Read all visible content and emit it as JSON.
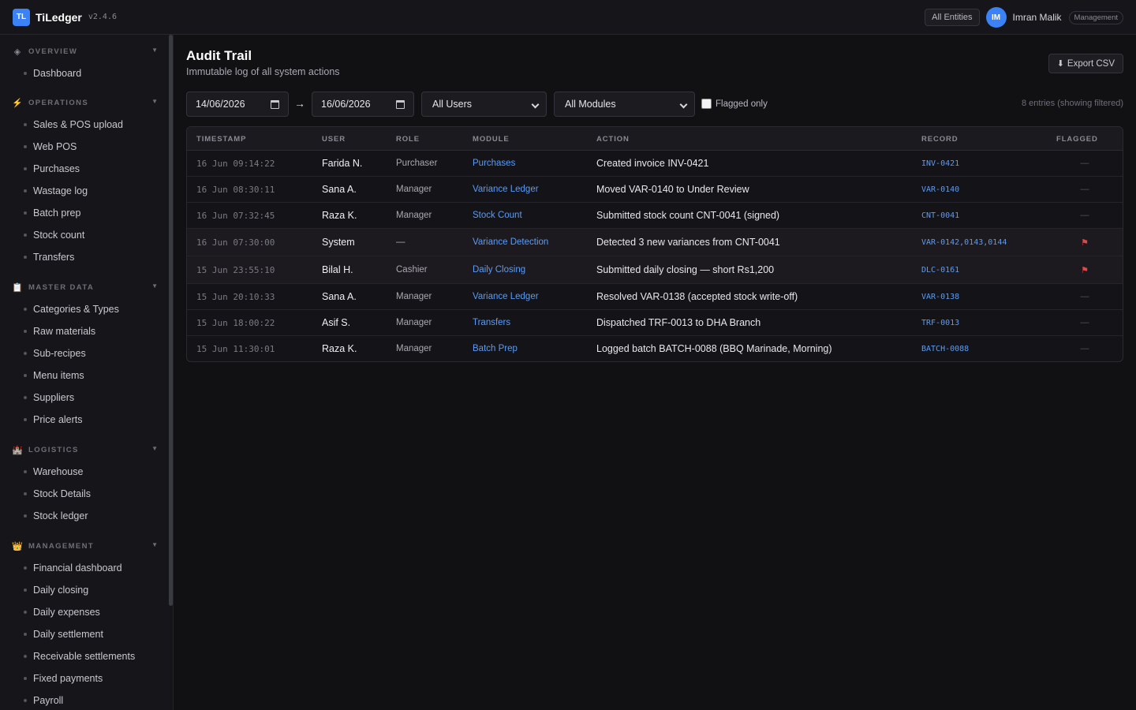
{
  "app": {
    "logo": "TL",
    "name": "TiLedger",
    "version": "v2.4.6"
  },
  "topbar": {
    "entities_label": "All Entities",
    "avatar_initials": "IM",
    "user_name": "Imran Malik",
    "role_badge": "Management"
  },
  "sidebar": {
    "sections": [
      {
        "title": "OVERVIEW",
        "icon": "diamond-icon",
        "icon_glyph": "◈",
        "items": [
          "Dashboard"
        ]
      },
      {
        "title": "OPERATIONS",
        "icon": "lightning-icon",
        "icon_glyph": "⚡",
        "items": [
          "Sales & POS upload",
          "Web POS",
          "Purchases",
          "Wastage log",
          "Batch prep",
          "Stock count",
          "Transfers"
        ]
      },
      {
        "title": "MASTER DATA",
        "icon": "clipboard-icon",
        "icon_glyph": "📋",
        "items": [
          "Categories & Types",
          "Raw materials",
          "Sub-recipes",
          "Menu items",
          "Suppliers",
          "Price alerts"
        ]
      },
      {
        "title": "LOGISTICS",
        "icon": "castle-icon",
        "icon_glyph": "🏰",
        "items": [
          "Warehouse",
          "Stock Details",
          "Stock ledger"
        ]
      },
      {
        "title": "MANAGEMENT",
        "icon": "crown-icon",
        "icon_glyph": "👑",
        "items": [
          "Financial dashboard",
          "Daily closing",
          "Daily expenses",
          "Daily settlement",
          "Receivable settlements",
          "Fixed payments",
          "Payroll"
        ]
      }
    ]
  },
  "page": {
    "title": "Audit Trail",
    "subtitle": "Immutable log of all system actions",
    "export_label": "Export CSV",
    "export_icon": "download-icon"
  },
  "filters": {
    "date_from": "14/06/2026",
    "arrow": "→",
    "date_to": "16/06/2026",
    "user_select": "All Users",
    "module_select": "All Modules",
    "flagged_label": "Flagged only",
    "flagged_checked": false,
    "entries_text": "8 entries (showing filtered)"
  },
  "table": {
    "columns": [
      "TIMESTAMP",
      "USER",
      "ROLE",
      "MODULE",
      "ACTION",
      "RECORD",
      "FLAGGED"
    ],
    "rows": [
      {
        "timestamp": "16 Jun 09:14:22",
        "user": "Farida N.",
        "role": "Purchaser",
        "module": "Purchases",
        "action": "Created invoice INV-0421",
        "record": "INV-0421",
        "flagged": false,
        "flag_text": "—"
      },
      {
        "timestamp": "16 Jun 08:30:11",
        "user": "Sana A.",
        "role": "Manager",
        "module": "Variance Ledger",
        "action": "Moved VAR-0140 to Under Review",
        "record": "VAR-0140",
        "flagged": false,
        "flag_text": "—"
      },
      {
        "timestamp": "16 Jun 07:32:45",
        "user": "Raza K.",
        "role": "Manager",
        "module": "Stock Count",
        "action": "Submitted stock count CNT-0041 (signed)",
        "record": "CNT-0041",
        "flagged": false,
        "flag_text": "—"
      },
      {
        "timestamp": "16 Jun 07:30:00",
        "user": "System",
        "role": "—",
        "module": "Variance Detection",
        "action": "Detected 3 new variances from CNT-0041",
        "record": "VAR-0142,0143,0144",
        "flagged": true,
        "flag_text": "⚑"
      },
      {
        "timestamp": "15 Jun 23:55:10",
        "user": "Bilal H.",
        "role": "Cashier",
        "module": "Daily Closing",
        "action": "Submitted daily closing — short Rs1,200",
        "record": "DLC-0161",
        "flagged": true,
        "flag_text": "⚑"
      },
      {
        "timestamp": "15 Jun 20:10:33",
        "user": "Sana A.",
        "role": "Manager",
        "module": "Variance Ledger",
        "action": "Resolved VAR-0138 (accepted stock write-off)",
        "record": "VAR-0138",
        "flagged": false,
        "flag_text": "—"
      },
      {
        "timestamp": "15 Jun 18:00:22",
        "user": "Asif S.",
        "role": "Manager",
        "module": "Transfers",
        "action": "Dispatched TRF-0013 to DHA Branch",
        "record": "TRF-0013",
        "flagged": false,
        "flag_text": "—"
      },
      {
        "timestamp": "15 Jun 11:30:01",
        "user": "Raza K.",
        "role": "Manager",
        "module": "Batch Prep",
        "action": "Logged batch BATCH-0088 (BBQ Marinade, Morning)",
        "record": "BATCH-0088",
        "flagged": false,
        "flag_text": "—"
      }
    ]
  },
  "colors": {
    "accent": "#3b82f6",
    "link": "#5b9bf5",
    "flag": "#e24646",
    "background": "#111114",
    "panel": "#16161a"
  }
}
